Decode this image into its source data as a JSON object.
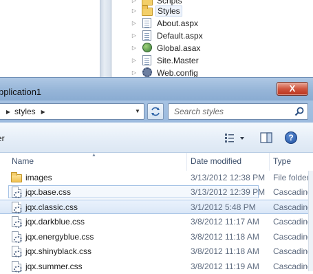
{
  "background_tree": {
    "items": [
      {
        "label": "Scripts",
        "icon": "folder-icon",
        "selected": false
      },
      {
        "label": "Styles",
        "icon": "folder-icon",
        "selected": true
      },
      {
        "label": "About.aspx",
        "icon": "aspx-page-icon",
        "selected": false
      },
      {
        "label": "Default.aspx",
        "icon": "aspx-page-icon",
        "selected": false
      },
      {
        "label": "Global.asax",
        "icon": "global-asax-icon",
        "selected": false
      },
      {
        "label": "Site.Master",
        "icon": "master-page-icon",
        "selected": false
      },
      {
        "label": "Web.config",
        "icon": "config-gear-icon",
        "selected": false
      }
    ]
  },
  "dialog": {
    "title": "pplication1",
    "close_label": "X",
    "address": {
      "crumb": "styles"
    },
    "search": {
      "placeholder": "Search styles"
    },
    "toolbar": {
      "organize_label": "er",
      "help_label": "?"
    },
    "columns": {
      "name": "Name",
      "date": "Date modified",
      "type": "Type"
    },
    "files": [
      {
        "name": "images",
        "date": "3/13/2012 12:38 PM",
        "type": "File folder",
        "icon": "folder-icon",
        "state": "normal"
      },
      {
        "name": "jqx.base.css",
        "date": "3/13/2012 12:39 PM",
        "type": "Cascading",
        "icon": "css-file-icon",
        "state": "outlined"
      },
      {
        "name": "jqx.classic.css",
        "date": "3/1/2012 5:48 PM",
        "type": "Cascading",
        "icon": "css-file-icon",
        "state": "selected"
      },
      {
        "name": "jqx.darkblue.css",
        "date": "3/8/2012 11:17 AM",
        "type": "Cascading",
        "icon": "css-file-icon",
        "state": "normal"
      },
      {
        "name": "jqx.energyblue.css",
        "date": "3/8/2012 11:18 AM",
        "type": "Cascading",
        "icon": "css-file-icon",
        "state": "normal"
      },
      {
        "name": "jqx.shinyblack.css",
        "date": "3/8/2012 11:18 AM",
        "type": "Cascading",
        "icon": "css-file-icon",
        "state": "normal"
      },
      {
        "name": "jqx.summer.css",
        "date": "3/8/2012 11:19 AM",
        "type": "Cascading",
        "icon": "css-file-icon",
        "state": "normal"
      }
    ]
  },
  "colors": {
    "titlebar": "#96b5d8",
    "close_button": "#d0563f",
    "selection": "#dae7f7"
  }
}
